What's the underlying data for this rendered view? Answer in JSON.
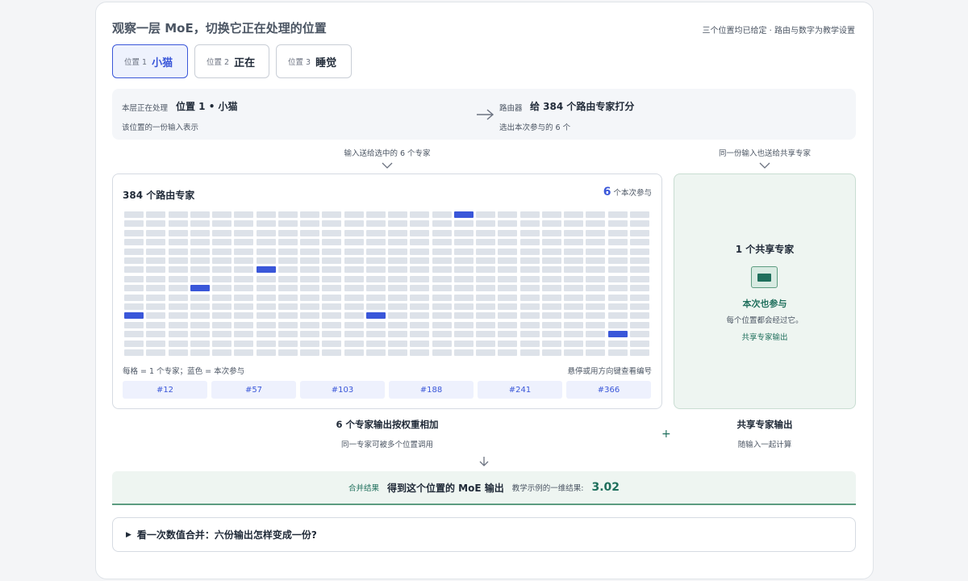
{
  "header": {
    "title": "观察一层 MoE，切换它正在处理的位置",
    "note": "三个位置均已给定 · 路由与数字为教学设置"
  },
  "tabs": [
    {
      "num": "位置 1",
      "word": "小猫",
      "active": true
    },
    {
      "num": "位置 2",
      "word": "正在",
      "active": false
    },
    {
      "num": "位置 3",
      "word": "睡觉",
      "active": false
    }
  ],
  "infobar": {
    "current_label": "本层正在处理",
    "current_value": "位置 1 • 小猫",
    "current_sub": "该位置的一份输入表示",
    "router_label": "路由器",
    "router_value": "给 384 个路由专家打分",
    "router_sub": "选出本次参与的 6 个"
  },
  "flow": {
    "to_selected": "输入送给选中的 6 个专家",
    "to_shared": "同一份输入也送给共享专家"
  },
  "experts": {
    "title": "384 个路由专家",
    "active_count": "6",
    "active_label": "个本次参与",
    "total": 384,
    "columns": 24,
    "active_ids": [
      12,
      57,
      103,
      188,
      241,
      366
    ],
    "legend_left": "每格 = 1 个专家；蓝色 = 本次参与",
    "legend_right": "悬停或用方向键查看编号",
    "chips": [
      "#12",
      "#57",
      "#103",
      "#188",
      "#241",
      "#366"
    ]
  },
  "shared": {
    "title": "1 个共享专家",
    "active": "本次也参与",
    "desc": "每个位置都会经过它。",
    "output": "共享专家输出"
  },
  "combine": {
    "left_title": "6 个专家输出按权重相加",
    "left_sub": "同一专家可被多个位置调用",
    "plus": "+",
    "right_title": "共享专家输出",
    "right_sub": "随输入一起计算"
  },
  "result": {
    "label": "合并结果",
    "main": "得到这个位置的 MoE 输出",
    "calc_label": "教学示例的一维结果:",
    "value": "3.02"
  },
  "details": {
    "summary": "看一次数值合并：六份输出怎样变成一份?"
  },
  "colors": {
    "accent_blue": "#3a57d9",
    "accent_green": "#1f6f5c",
    "cell_idle": "#dde2e9"
  }
}
